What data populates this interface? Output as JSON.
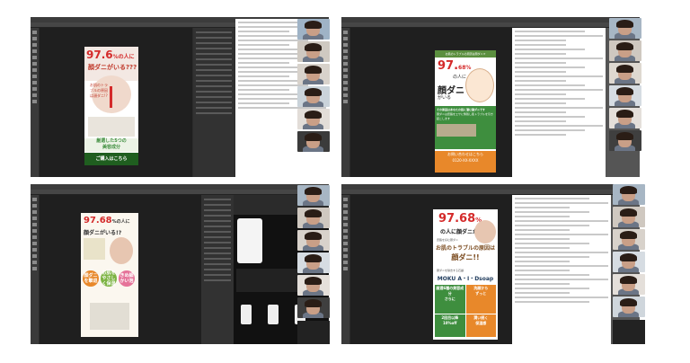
{
  "panels": {
    "tl": {
      "ad_headline_num": "97.6",
      "ad_headline_unit": "%の人に",
      "ad_headline_2": "顔ダニがいる???",
      "ad_bubble": "お肌のトラブルの原因は顔ダニ!?",
      "ad_green_bar": "厳選した5つの",
      "ad_green_bar_2": "美容成分",
      "ad_button": "ご購入はこちら"
    },
    "tr": {
      "ad_top_bar": "お肌のトラブルの原因は顔ダニ!?",
      "ad_num": "97.",
      "ad_num_small": "68%",
      "ad_sub": "の人に",
      "ad_face_word": "顔ダニ",
      "ad_face_word_small": "がいる",
      "ad_green_heading": "その原因はあなたの肌に潜む顔ダニです",
      "ad_green_body": "顔ダニは皮脂をエサに繁殖し肌トラブルを引き起こします",
      "ad_bottom": "お問い合わせはこちら",
      "ad_phone": "0120-XX-XXXX"
    },
    "bl": {
      "ad_num": "97.68",
      "ad_num_unit": "%の人に",
      "ad_line_2": "顔ダニがいる!?",
      "circle_1": "顔ダニを撃退",
      "circle_2": "お肌をやさしく保湿",
      "circle_3": "きめ細かい泡"
    },
    "br": {
      "ad_num": "97.68",
      "ad_num_unit": "%",
      "ad_line_2": "の人に顔ダニが!?",
      "ad_small": "皮脂を好む顔ダニ",
      "ad_cause_1": "お肌のトラブルの原因は",
      "ad_cause_2": "顔ダニ!!",
      "ad_small_2": "顔ダニを除去する石鹸",
      "ad_product": "MOKU A・I・Dsoap",
      "cells": [
        "厳選6種の美容成分",
        "洗顔から",
        "ずっと",
        "潤い続く",
        "さらに",
        "2回目以降",
        "保湿感",
        "10%off"
      ]
    }
  },
  "colors": {
    "accent_red": "#d42a2a",
    "green": "#3e8e3e",
    "orange": "#e8882a"
  }
}
